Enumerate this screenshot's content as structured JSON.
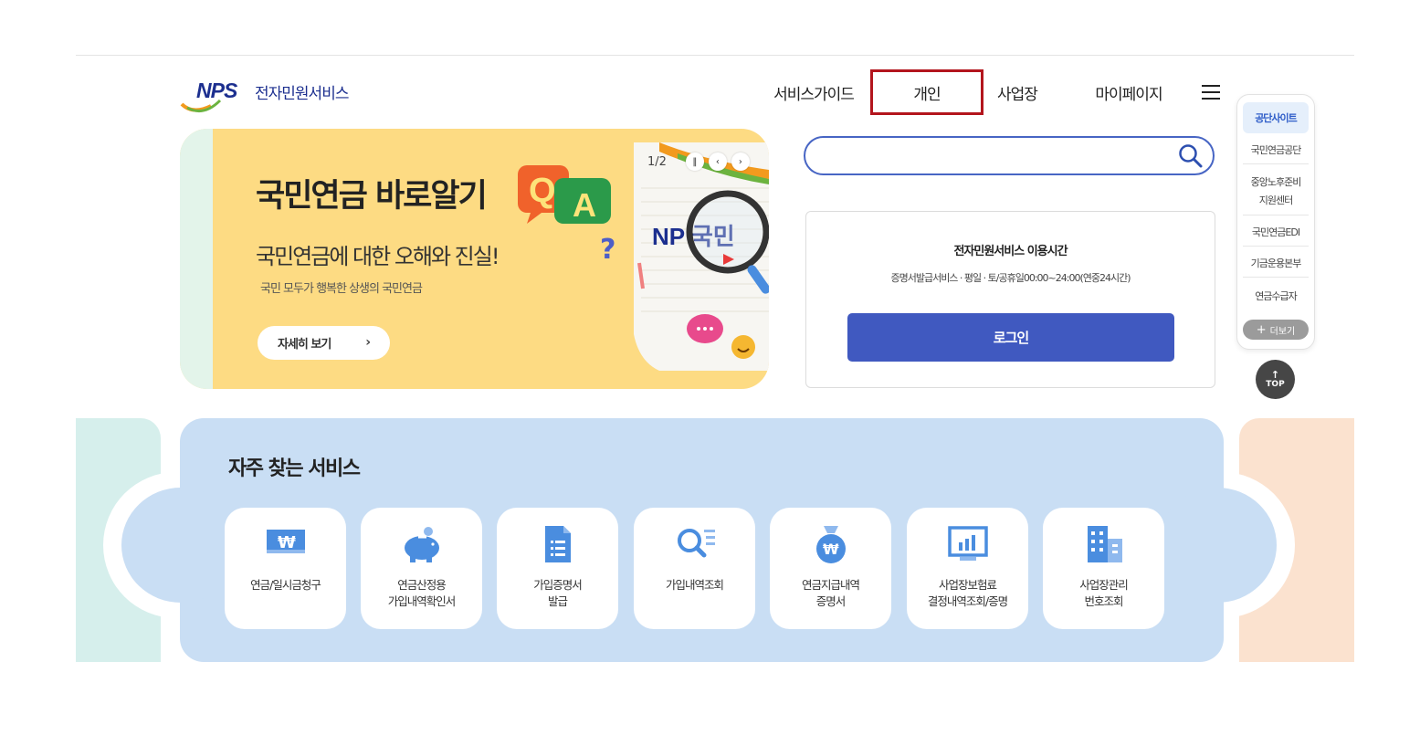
{
  "header": {
    "logo_mark": "NPS",
    "logo_text": "전자민원서비스",
    "nav": [
      {
        "label": "서비스가이드"
      },
      {
        "label": "개인"
      },
      {
        "label": "사업장"
      },
      {
        "label": "마이페이지"
      }
    ]
  },
  "banner": {
    "title": "국민연금 바로알기",
    "badge_q": "Q",
    "badge_a": "A",
    "subtitle": "국민연금에 대한 오해와 진실!",
    "question_mark": "?",
    "desc": "국민 모두가 행복한 상생의 국민연금",
    "more_label": "자세히 보기",
    "pager": "1/2",
    "art_text": "NP 국민"
  },
  "search": {
    "value": "",
    "placeholder": ""
  },
  "info": {
    "title": "전자민원서비스 이용시간",
    "desc": "증명서발급서비스 · 평일 · 토/공휴일00:00~24:00(연중24시간)",
    "login_label": "로그인"
  },
  "side": {
    "head": "공단사이트",
    "items": [
      "국민연금공단",
      "중앙노후준비\n지원센터",
      "국민연금EDI",
      "기금운용본부",
      "연금수급자"
    ],
    "more_label": "더보기",
    "top_label": "TOP"
  },
  "frequent": {
    "title": "자주 찾는 서비스",
    "items": [
      {
        "label": "연금/일시금청구",
        "icon": "won-card-icon"
      },
      {
        "label": "연금산정용\n가입내역확인서",
        "icon": "piggy-bank-icon"
      },
      {
        "label": "가입증명서\n발급",
        "icon": "document-icon"
      },
      {
        "label": "가입내역조회",
        "icon": "search-list-icon"
      },
      {
        "label": "연금지급내역\n증명서",
        "icon": "money-bag-icon"
      },
      {
        "label": "사업장보험료\n결정내역조회/증명",
        "icon": "chart-monitor-icon"
      },
      {
        "label": "사업장관리\n번호조회",
        "icon": "building-icon"
      }
    ]
  },
  "colors": {
    "brand": "#1c2f8f",
    "accent": "#4059c0",
    "highlight": "#b3151d",
    "banner_bg": "#fddb83",
    "frequent_bg": "#c9def4",
    "icon_blue": "#4a8ddf"
  }
}
